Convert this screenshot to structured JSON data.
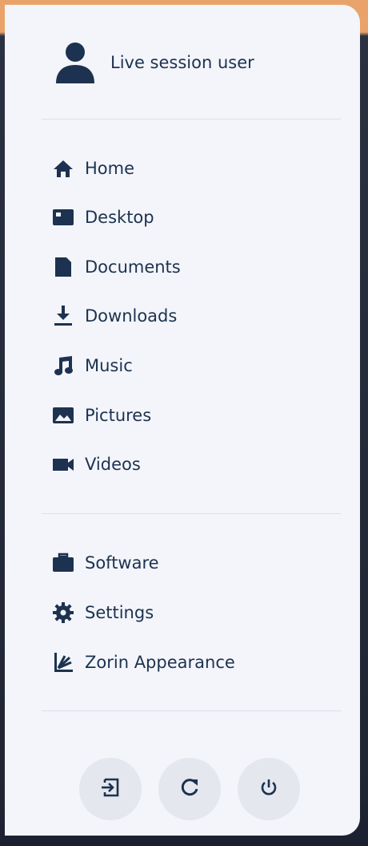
{
  "user": {
    "name": "Live session user",
    "icon": "user-icon"
  },
  "places": [
    {
      "label": "Home",
      "icon": "home-icon"
    },
    {
      "label": "Desktop",
      "icon": "desktop-icon"
    },
    {
      "label": "Documents",
      "icon": "document-icon"
    },
    {
      "label": "Downloads",
      "icon": "download-icon"
    },
    {
      "label": "Music",
      "icon": "music-icon"
    },
    {
      "label": "Pictures",
      "icon": "picture-icon"
    },
    {
      "label": "Videos",
      "icon": "video-icon"
    }
  ],
  "apps": [
    {
      "label": "Software",
      "icon": "briefcase-icon"
    },
    {
      "label": "Settings",
      "icon": "gear-icon"
    },
    {
      "label": "Zorin Appearance",
      "icon": "appearance-icon"
    }
  ],
  "power": [
    {
      "icon": "logout-icon"
    },
    {
      "icon": "restart-icon"
    },
    {
      "icon": "power-icon"
    }
  ],
  "colors": {
    "panel_bg": "#f3f5fa",
    "text": "#1d3250",
    "button_bg": "#e4e7ee",
    "accent_wallpaper": "#e9a36a"
  }
}
